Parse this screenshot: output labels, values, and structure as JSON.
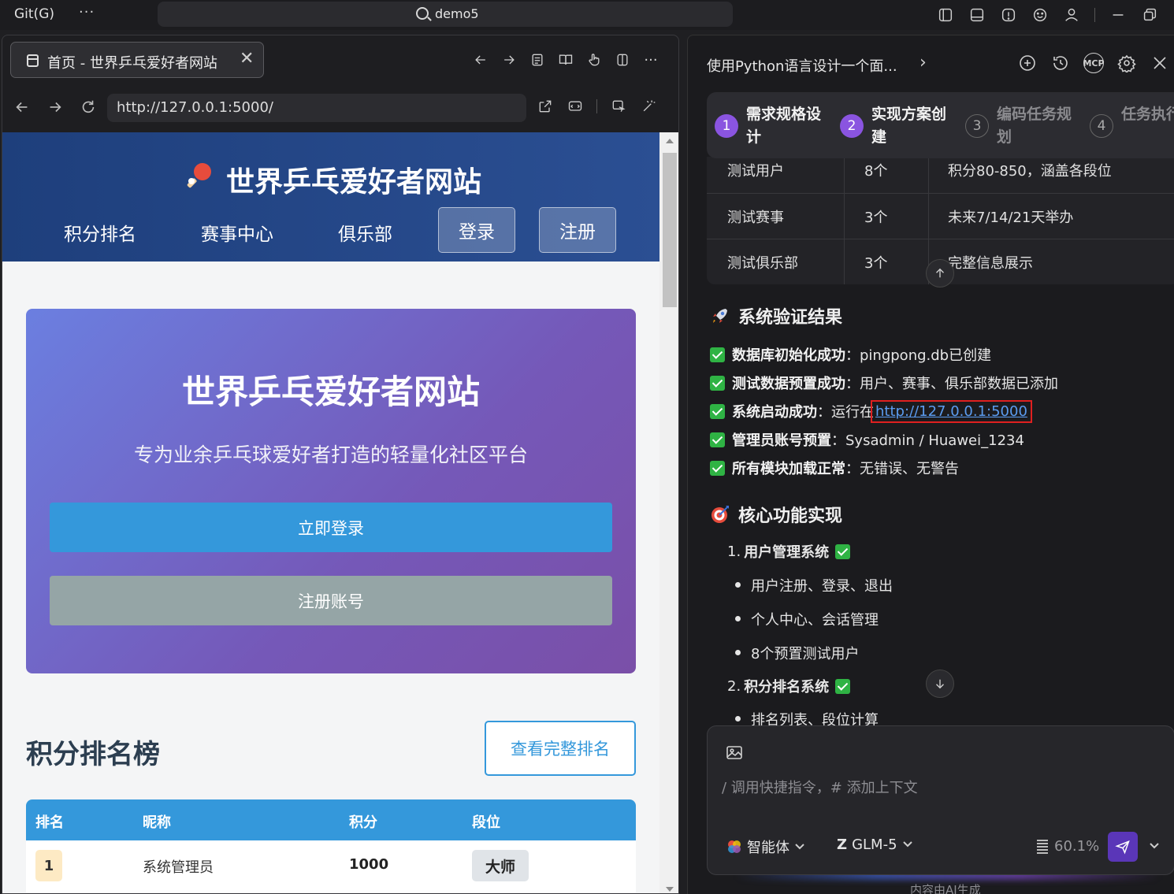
{
  "topbar": {
    "menu_git": "Git(G)",
    "more": "···",
    "search_text": "demo5"
  },
  "browser": {
    "tab_title": "首页 - 世界乒乓爱好者网站",
    "url": "http://127.0.0.1:5000/"
  },
  "site": {
    "title": "世界乒乓爱好者网站",
    "nav": {
      "rankings": "积分排名",
      "events": "赛事中心",
      "clubs": "俱乐部",
      "login": "登录",
      "register": "注册"
    },
    "hero": {
      "title": "世界乒乓爱好者网站",
      "subtitle": "专为业余乒乓球爱好者打造的轻量化社区平台",
      "login_button": "立即登录",
      "register_button": "注册账号"
    },
    "ranking": {
      "title": "积分排名榜",
      "more_button": "查看完整排名",
      "headers": [
        "排名",
        "昵称",
        "积分",
        "段位"
      ],
      "rows": [
        {
          "rank": "1",
          "nickname": "系统管理员",
          "score": "1000",
          "level": "大师"
        }
      ]
    }
  },
  "ai": {
    "title": "使用Python语言设计一个面...",
    "steps": [
      {
        "num": "1",
        "label": "需求规格设计"
      },
      {
        "num": "2",
        "label": "实现方案创建"
      },
      {
        "num": "3",
        "label": "编码任务规划"
      },
      {
        "num": "4",
        "label": "任务执行"
      }
    ],
    "table_rows": [
      {
        "item": "测试用户",
        "count": "8个",
        "desc": "积分80-850，涵盖各段位"
      },
      {
        "item": "测试赛事",
        "count": "3个",
        "desc": "未来7/14/21天举办"
      },
      {
        "item": "测试俱乐部",
        "count": "3个",
        "desc": "完整信息展示"
      }
    ],
    "verify_heading": "系统验证结果",
    "checks": [
      {
        "bold": "数据库初始化成功",
        "text": "：pingpong.db已创建"
      },
      {
        "bold": "测试数据预置成功",
        "text": "：用户、赛事、俱乐部数据已添加"
      },
      {
        "bold": "系统启动成功",
        "text": "：运行在 ",
        "link": "http://127.0.0.1:5000"
      },
      {
        "bold": "管理员账号预置",
        "text": "：Sysadmin / Huawei_1234"
      },
      {
        "bold": "所有模块加载正常",
        "text": "：无错误、无警告"
      }
    ],
    "features_heading": "核心功能实现",
    "features": [
      {
        "num": "1.",
        "title": "用户管理系统",
        "bullets": [
          "用户注册、登录、退出",
          "个人中心、会话管理",
          "8个预置测试用户"
        ]
      },
      {
        "num": "2.",
        "title": "积分排名系统",
        "bullets": [
          "排名列表、段位计算"
        ]
      }
    ],
    "input_placeholder": "/ 调用快捷指令，# 添加上下文",
    "agent_label": "智能体",
    "model_label": "GLM-5",
    "usage": "60.1%",
    "footnote": "内容由AI生成"
  },
  "colors": {
    "site_header": "#1e3f7c",
    "hero_gradient_start": "#6b7fe0",
    "hero_gradient_end": "#7a4fa8",
    "primary_blue": "#3498db",
    "gray_button": "#95a5a6",
    "step_active": "#8a54e0",
    "check_green": "#2fb344",
    "highlight_red": "#e02020"
  }
}
